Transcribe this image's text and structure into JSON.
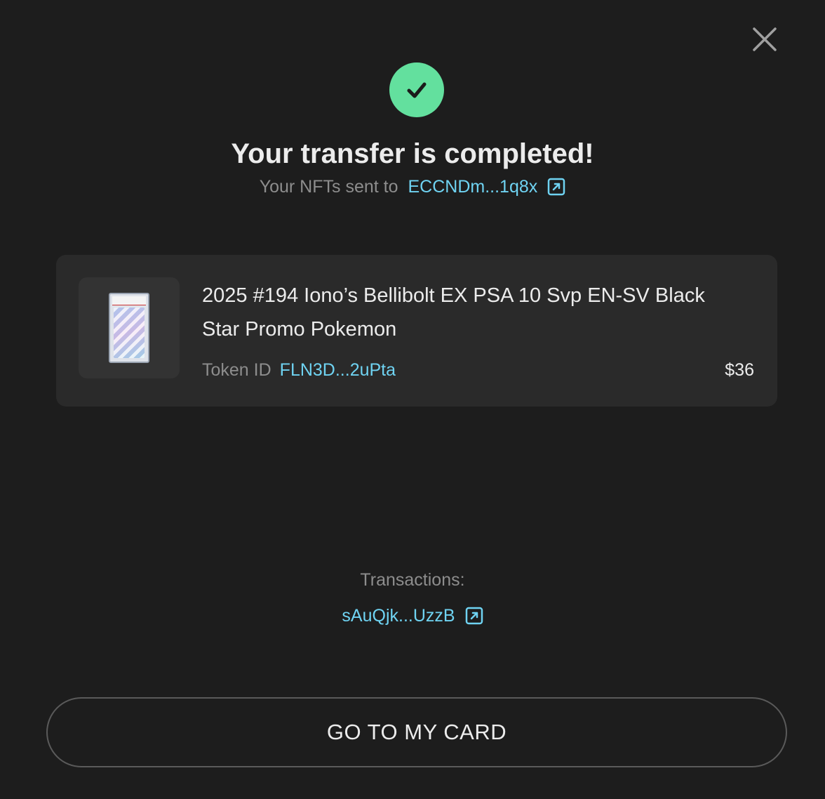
{
  "colors": {
    "background": "#1d1d1d",
    "success": "#63e09e",
    "link": "#6fd3f2",
    "muted_text": "#8d8d8d",
    "card_background": "#2a2a2a"
  },
  "icons": {
    "close": "close-icon",
    "success": "check-icon",
    "external_link": "external-link-icon"
  },
  "header": {
    "title": "Your transfer is completed!",
    "sent_to_label": "Your NFTs sent to",
    "recipient_address": "ECCNDm...1q8x"
  },
  "nft": {
    "name": "2025 #194 Iono’s Bellibolt EX PSA 10 Svp EN-SV Black Star Promo Pokemon",
    "token_id_label": "Token ID",
    "token_id": "FLN3D...2uPta",
    "price": "$36"
  },
  "transactions": {
    "label": "Transactions:",
    "items": [
      {
        "hash": "sAuQjk...UzzB"
      }
    ]
  },
  "actions": {
    "primary_label": "GO TO MY CARD"
  }
}
